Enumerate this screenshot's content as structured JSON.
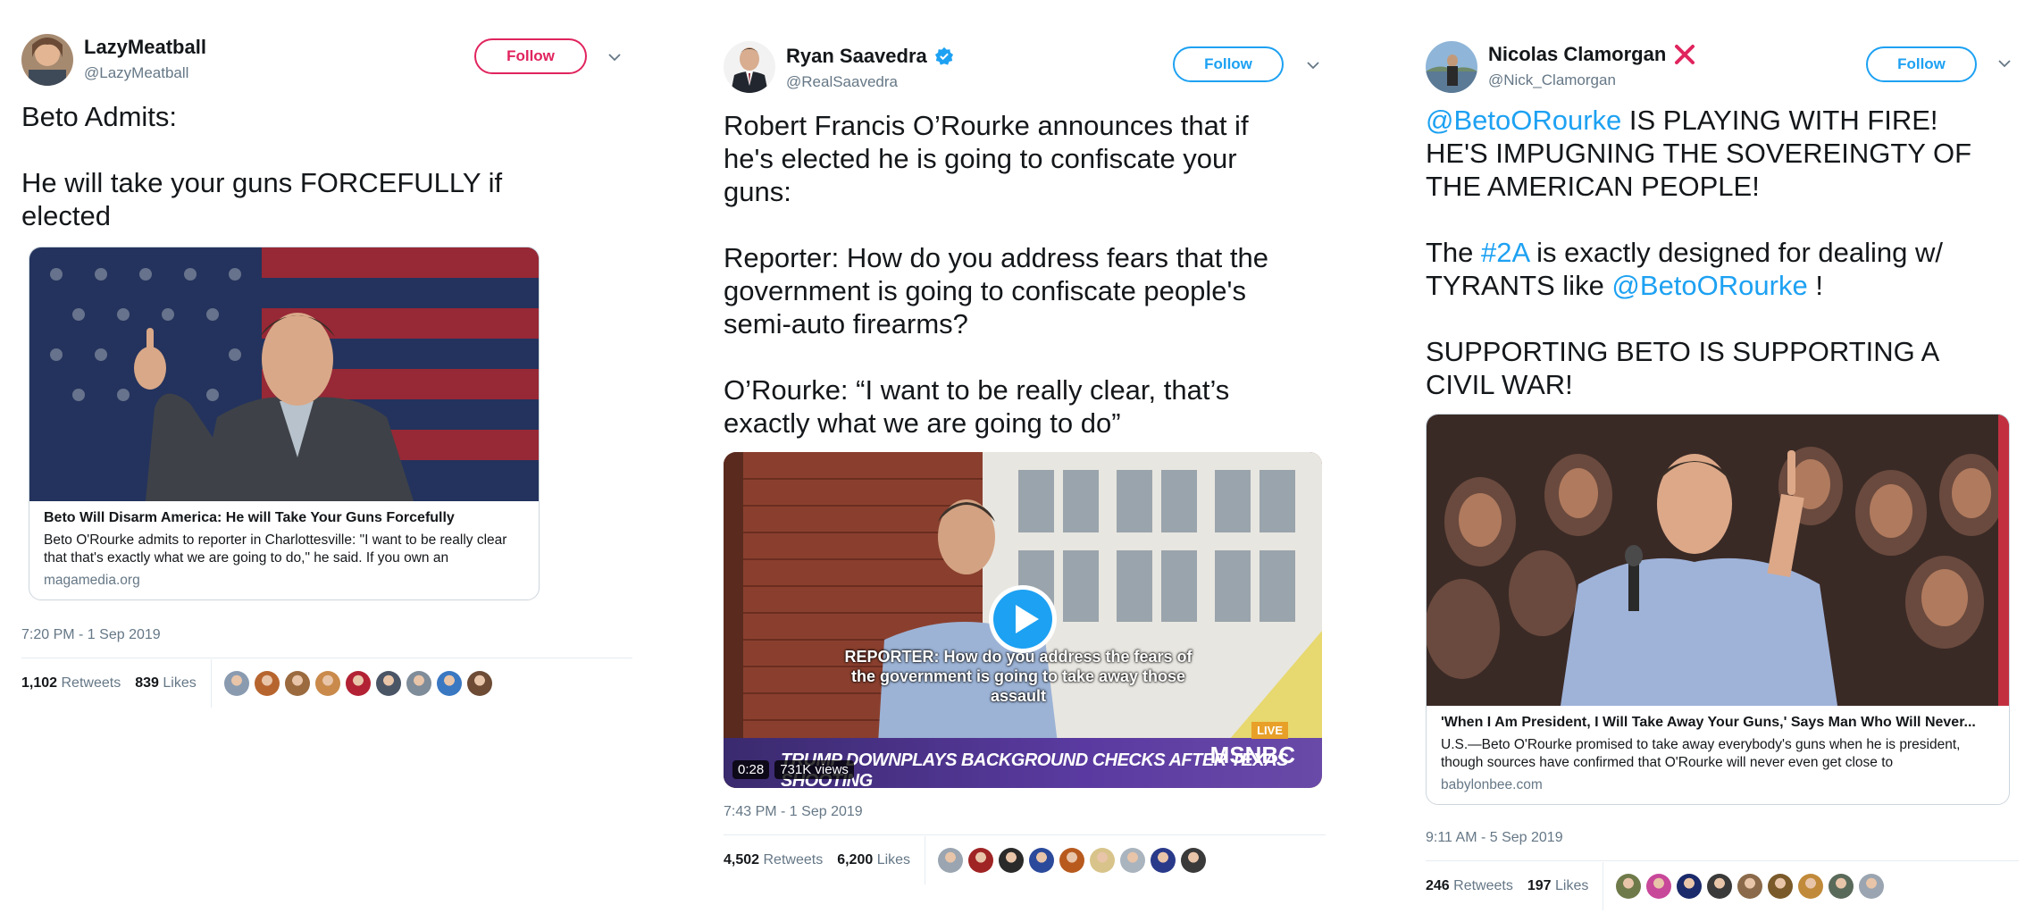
{
  "tweets": [
    {
      "display_name": "LazyMeatball",
      "handle": "@LazyMeatball",
      "follow_label": "Follow",
      "text": "Beto Admits:\n\nHe will take your guns FORCEFULLY if\nelected",
      "card": {
        "title": "Beto Will Disarm America: He will Take Your Guns Forcefully",
        "description": "Beto O'Rourke admits to reporter in Charlottesville: \"I want to be really clear that that's exactly what we are going to do,\" he said. If you own an",
        "domain": "magamedia.org"
      },
      "timestamp": "7:20 PM - 1 Sep 2019",
      "retweets": "1,102",
      "retweets_label": "Retweets",
      "likes": "839",
      "likes_label": "Likes",
      "liker_colors": [
        "#8a9bb0",
        "#b7652f",
        "#9b6a3f",
        "#c98a4b",
        "#b22234",
        "#4a5566",
        "#7f8c99",
        "#3a78c2",
        "#6d4b35"
      ]
    },
    {
      "display_name": "Ryan Saavedra",
      "verified": true,
      "handle": "@RealSaavedra",
      "follow_label": "Follow",
      "text": "Robert Francis O’Rourke announces that if\nhe's elected he is going to confiscate your\nguns:\n\nReporter: How do you address fears that the\ngovernment is going to confiscate people's\nsemi-auto firearms?\n\nO’Rourke: “I want to be really clear, that’s\nexactly what we are going to do”",
      "video": {
        "caption": "REPORTER: How do you address the fears of the government is going to take away those assault",
        "ticker": "TRUMP DOWNPLAYS BACKGROUND CHECKS AFTER TEXAS SHOOTING",
        "live": "LIVE",
        "network": "MSNBC",
        "duration": "0:28",
        "views": "731K views"
      },
      "timestamp": "7:43 PM - 1 Sep 2019",
      "retweets": "4,502",
      "retweets_label": "Retweets",
      "likes": "6,200",
      "likes_label": "Likes",
      "liker_colors": [
        "#9aa5b1",
        "#a02424",
        "#2a2a2a",
        "#2b4a9b",
        "#b85a1e",
        "#d8c48a",
        "#aab4be",
        "#2a3a8a",
        "#3a3a3a"
      ]
    },
    {
      "display_name": "Nicolas Clamorgan",
      "badge": "❌",
      "handle": "@Nick_Clamorgan",
      "follow_label": "Follow",
      "text_parts": [
        {
          "t": "@BetoORourke",
          "link": true
        },
        {
          "t": " IS PLAYING WITH FIRE!\nHE'S IMPUGNING THE SOVEREINGTY OF\nTHE AMERICAN PEOPLE!\n\nThe ",
          "link": false
        },
        {
          "t": "#2A",
          "link": true
        },
        {
          "t": " is exactly designed for dealing w/\nTYRANTS like ",
          "link": false
        },
        {
          "t": "@BetoORourke",
          "link": true
        },
        {
          "t": " !\n\nSUPPORTING BETO IS SUPPORTING A\nCIVIL WAR!",
          "link": false
        }
      ],
      "card": {
        "title": "'When I Am President, I Will Take Away Your Guns,' Says Man Who Will Never...",
        "description": "U.S.—Beto O'Rourke promised to take away everybody's guns when he is president, though sources have confirmed that O'Rourke will never even get close to",
        "domain": "babylonbee.com"
      },
      "timestamp": "9:11 AM - 5 Sep 2019",
      "retweets": "246",
      "retweets_label": "Retweets",
      "likes": "197",
      "likes_label": "Likes",
      "liker_colors": [
        "#6f7a4a",
        "#c8489a",
        "#1a2a6a",
        "#3a3a3a",
        "#8a6a4a",
        "#7a5a2a",
        "#c08a3a",
        "#5a6a5a",
        "#9aa5b1"
      ]
    }
  ],
  "icons": {
    "chevron": "chevron-down-icon",
    "verified": "verified-badge-icon",
    "play": "play-icon"
  },
  "colors": {
    "follow_red": "#e0245e",
    "follow_blue": "#1da1f2",
    "link": "#1da1f2",
    "muted": "#657786"
  }
}
